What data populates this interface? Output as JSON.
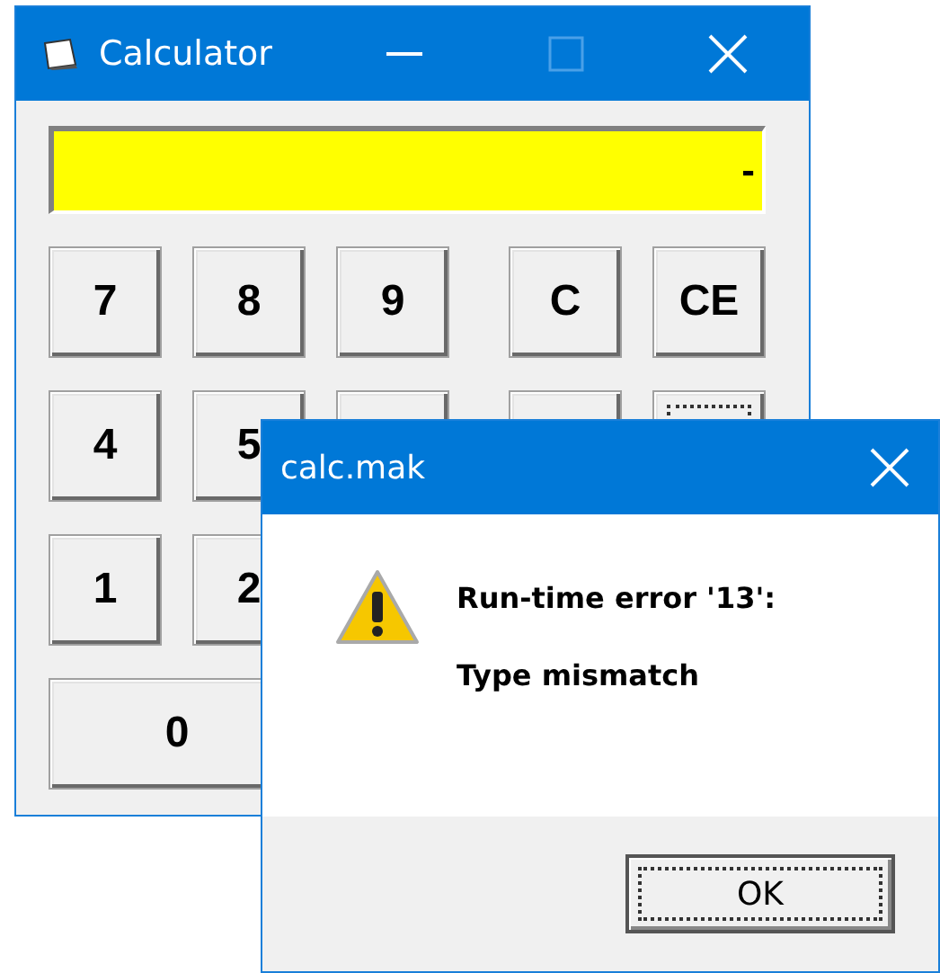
{
  "calculator": {
    "title": "Calculator",
    "minimize": {
      "disabled": false
    },
    "maximize": {
      "disabled": true
    },
    "display": {
      "value": "-"
    },
    "keypad": [
      [
        {
          "label": "7",
          "focused": false,
          "wide": false
        },
        {
          "label": "8",
          "focused": false,
          "wide": false
        },
        {
          "label": "9",
          "focused": false,
          "wide": false
        },
        {
          "label": "C",
          "focused": false,
          "wide": false
        },
        {
          "label": "CE",
          "focused": false,
          "wide": false
        }
      ],
      [
        {
          "label": "4",
          "focused": false,
          "wide": false
        },
        {
          "label": "5",
          "focused": false,
          "wide": false
        },
        {
          "focused": false,
          "wide": false
        },
        {
          "focused": false,
          "wide": false
        },
        {
          "focused": true,
          "wide": false
        }
      ],
      [
        {
          "label": "1",
          "focused": false,
          "wide": false
        },
        {
          "label": "2",
          "focused": false,
          "wide": false
        }
      ],
      [
        {
          "label": "0",
          "focused": false,
          "wide": true
        }
      ]
    ]
  },
  "dialog": {
    "title": "calc.mak",
    "lines": [
      "Run-time error '13':",
      "Type mismatch"
    ],
    "button": {
      "label": "OK",
      "focused": true
    }
  }
}
